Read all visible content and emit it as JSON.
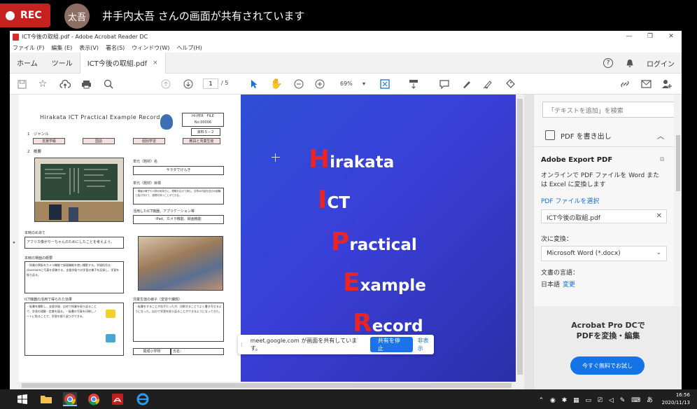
{
  "share": {
    "rec_label": "REC",
    "avatar_initials": "太吾",
    "text": "井手内太吾 さんの画面が共有されています"
  },
  "window": {
    "title": "ICT今後の取組.pdf - Adobe Acrobat Reader DC",
    "controls": [
      "—",
      "❐",
      "✕"
    ]
  },
  "menu": [
    "ファイル (F)",
    "編集 (E)",
    "表示(V)",
    "署名(S)",
    "ウィンドウ(W)",
    "ヘルプ(H)"
  ],
  "tabs": {
    "home": "ホーム",
    "tools": "ツール",
    "doc": "ICT今後の取組.pdf",
    "close": "×",
    "help": "?",
    "login": "ログイン"
  },
  "toolbar": {
    "page_current": "1",
    "page_total": "/ 5",
    "zoom": "69%"
  },
  "page1": {
    "title": "Hirakata ICT Practical Example Record",
    "file_label": "HI-PER　FILE",
    "file_no": "No.00006",
    "doc_ref": "資料５−２",
    "genre_label": "1　ジャンル",
    "tags": [
      "支援学級",
      "国語",
      "個別学習",
      "教具と児童生徒"
    ],
    "overview_label": "2　概要",
    "unit_label": "単元（題材）名",
    "unit_value": "サラダでげんき",
    "goal_label": "単元（題材）目標",
    "goal_value": "・場面の様子や人物の気持ちに、想像を広げて読む。文章の内容を自分の経験と結び付けて、感想を持つことができる。",
    "ict_label": "活用したICT機器、アプリケーション等",
    "ict_value": "iPad、カメラ機能、録画機能",
    "aim_label": "本時のめあて",
    "aim_value": "アフリカ像がりーちゃんのためにしたことを考えよう。",
    "scene_label": "本時の場面の概要",
    "scene_value": "・授業の黒板をカメラ機能で録画機能を使い撮影する。学級担任はclassroomに写真を投稿する。支援学級での学習の様子を記録し、学習を振り返る。",
    "effect_label": "ICT機器の活用で得られた効果",
    "effect_value": "・板書を撮影し、支援学級、自宅で授業を振り返ることで、学習の理解・定着を図る。・板書の写真を印刷しノートに貼ることで、学習の振り返りができる。",
    "reaction_label": "児童生徒の様子（変容や課題）",
    "reaction_value": "・板書をすることが苦手だったが、印刷することでよく書き写せるようになった。自分で学習を振り返ることができるようになってきた。",
    "school_label": "関成小学校",
    "name_label": "氏名："
  },
  "page2": {
    "lines": [
      {
        "cap": "H",
        "rest": "irakata"
      },
      {
        "cap": "I",
        "rest": "CT"
      },
      {
        "cap": "P",
        "rest": "ractical"
      },
      {
        "cap": "E",
        "rest": "xample"
      },
      {
        "cap": "R",
        "rest": "ecord"
      }
    ]
  },
  "meet": {
    "message": "meet.google.com が画面を共有しています。",
    "stop": "共有を停止",
    "hide": "非表示"
  },
  "panel": {
    "search_placeholder": "「テキストを追加」を検索",
    "export_head": "PDF を書き出し",
    "ae_title": "Adobe Export PDF",
    "ae_desc": "オンラインで PDF ファイルを Word または Excel に変換します",
    "select_file": "PDF ファイルを選択",
    "file_name": "ICT今後の取組.pdf",
    "convert_label": "次に変換：",
    "convert_value": "Microsoft Word (*.docx)",
    "lang_label": "文書の言語：",
    "lang_value": "日本語",
    "lang_change": "変更",
    "promo_line1": "Acrobat Pro DCで",
    "promo_line2": "PDFを変換・編集",
    "promo_button": "今すぐ無料でお試し"
  },
  "taskbar": {
    "tray_ime": "あ",
    "time": "16:56",
    "date": "2020/11/13"
  }
}
